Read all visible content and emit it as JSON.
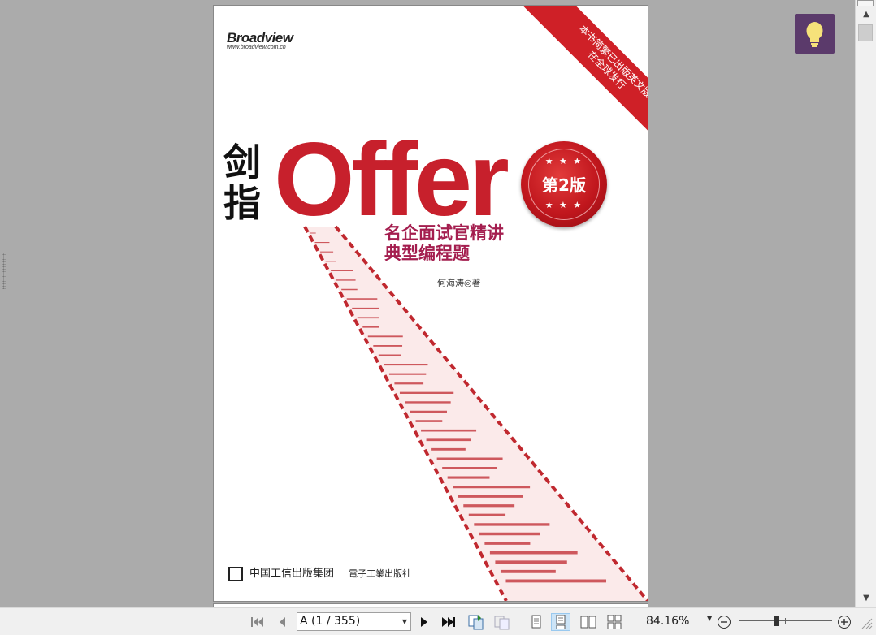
{
  "document": {
    "publisher_logo": "Broadview",
    "publisher_url": "www.broadview.com.cn",
    "banner_line1": "本书简繁已出版英文版",
    "banner_line2": "在全球发行",
    "title_cn": "剑指",
    "title_en": "Offer",
    "edition_badge": "第2版",
    "subtitle_line1": "名企面试官精讲",
    "subtitle_line2": "典型编程题",
    "author": "何海涛◎著",
    "publisher_bottom1": "中国工信出版集团",
    "publisher_bottom2": "電子工業出版社",
    "seal_stars": "★ ★ ★"
  },
  "navigation": {
    "page_selector": "A (1 / 355)"
  },
  "zoom": {
    "level_text": "84.16%",
    "slider_level": 0.39
  },
  "colors": {
    "accent_red": "#c7202c",
    "tip_button": "#5b3a6b",
    "active_view": "#cce4f7"
  },
  "icons": {
    "first_page": "first-page-icon",
    "prev_page": "previous-page-icon",
    "next_page": "next-page-icon",
    "last_page": "last-page-icon",
    "tip": "lightbulb-icon"
  }
}
